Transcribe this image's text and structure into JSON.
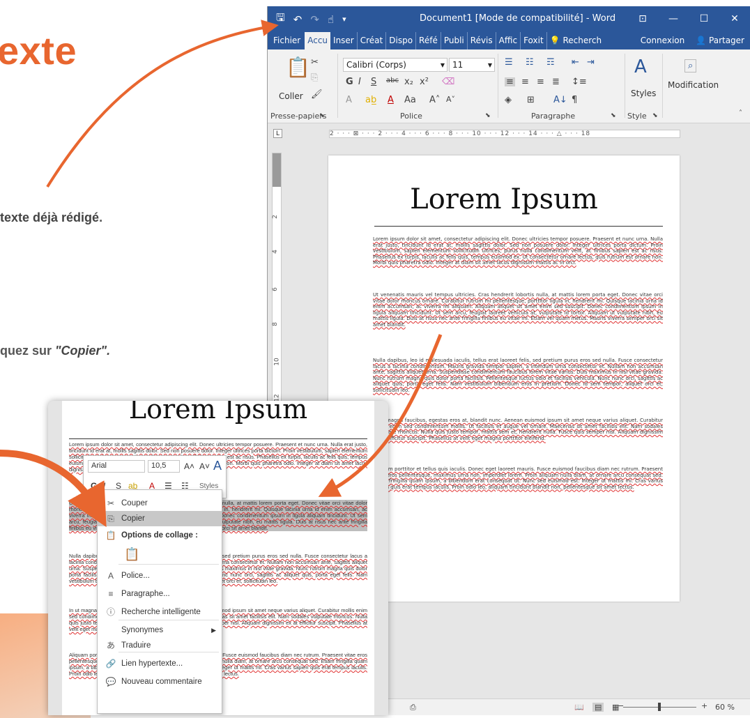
{
  "tutorial": {
    "heading": "exte",
    "line1_bold": "texte déjà rédigé",
    "line1_end": ".",
    "line2_start": "quez sur ",
    "line2_quote": "\"Copier\"."
  },
  "word": {
    "title": "Document1 [Mode de compatibilité] - Word",
    "tabs": [
      "Fichier",
      "Accu",
      "Inser",
      "Créat",
      "Dispo",
      "Réfé",
      "Publi",
      "Révis",
      "Affic",
      "Foxit"
    ],
    "tell_me": "Recherch",
    "connexion": "Connexion",
    "partager": "Partager",
    "ribbon": {
      "paste_label": "Coller",
      "font_name": "Calibri (Corps)",
      "font_size": "11",
      "styles_label": "Styles",
      "modification_label": "Modification",
      "groups": [
        "Presse-papiers",
        "Police",
        "Paragraphe",
        "Style"
      ]
    },
    "ruler_text": "2 · · · ⊠ · · · 2 · · · 4 · · · 6 · · · 8 · · · 10 · · · 12 · · · 14 · · · △ · · · 18",
    "vruler_numbers": [
      "2",
      "4",
      "6",
      "8",
      "10",
      "12"
    ],
    "page": {
      "title": "Lorem Ipsum",
      "paragraphs": [
        "Lorem ipsum dolor sit amet, consectetur adipiscing elit. Donec ultricies tempor posuere. Praesent et nunc urna. Nulla erat justo, tincidunt id erat at, mollis sagittis dolor. Sed non posuere dolor. Integer ultrices porta dictum. Proin vestibulum, sapien elementum sollicitudin ultrices, purus nulla condimentum velit, ac finibus sapien est ac risus. Phasellus ex turpis, iaculis ac felis quis, tempus euismod ex. Ut consectetur ornare lectus, quis rutrum est ornare non. Morbi quis pharetra odio. Integer at diam sit amet lacus dignissim mattis ac in orci.",
        "Ut venenatis mauris vel tempus ultricies. Cras hendrerit lobortis nulla, at mattis lorem porta eget. Donec vitae orci vitae dolor rhoncus ornare. Curabitur rutrum mi pellentesque, porttitor ligula in, hendrerit mi. Quisque lacinia urna id enim accumsan, ac viverra mi aliquam. Aliquam aliquet sit amet enim sed suscipit. Donec condimentum ipsum in ligula aliquam tincidunt. Ut sem arcu, feugiat laoreet vehicula at, vulputate id tortor. Aliquam ut vulputate nibh, eu mattis ligula. Duis at risus nec ante fringilla finibus eu vitae mi. Etiam vel quam metus. Mauris viverra semper orci sit amet blandit.",
        "Nulla dapibus, leo id malesuada iaculis, tellus erat laoreet felis, sed pretium purus eros sed nulla. Fusce consectetur lacus a lacinia condimentum. Mauris gravida tempor sapien, a interdum urna consectetur et. Nullam non accumsan ante, sagittis aliquet urna. Suspendisse condimentum faucibus lorem vitae varius. Duis maximus in nisl vitae gravida. Nunc rutrum magna quis dolor porta facilisis. Pellentesque luctus odio et facilisis vehicula. Nunc nunc orci, sagittis ac aliquet quis, porta eget felis. Nam vestibulum bibendum eros in pretium. Donec id sem tempor, aliquet orci et, sollicitudin leo.",
        "In ut magna faucibus, egestas eros at, blandit nunc. Aenean euismod ipsum sit amet neque varius aliquet. Curabitur mollis enim sed condimentum mollis. Ut facilisis et augue vel ornare. Maecenas sit amet facilisis elit. Nam sodales vulputate rhoncus. Nulla quis justo tempor, mattis sem et, hendrerit nulla. Fusce quis semper nisl. Aliquam dignissim ex at efficitur suscipit. Phasellus at velit eget magna porttitor eleifend.",
        "Aliquam porttitor et tellus quis iaculis. Donec eget laoreet mauris. Fusce euismod faucibus diam nec rutrum. Praesent vitae eros pellentesque, maximus urna non, imperdiet lorem. Proin aliquam nulla diam, at ornare arcu consequat sed. Etiam fringilla quam ipsum, a bibendum erat consequat ut. Nunc sed euismod est. Integer ut mattis mi. Cras varius sapien quis erat tempus iaculis. Proin odio leo, aliquam tincidunt blandit non, pellentesque sit amet lectus."
      ]
    },
    "status": {
      "zoom": "60 %"
    }
  },
  "inset": {
    "mini_toolbar": {
      "font": "Arial",
      "size": "10,5",
      "styles": "Styles"
    },
    "context_menu": [
      {
        "label": "Couper",
        "icon": "scissors-icon",
        "glyph": "✂"
      },
      {
        "label": "Copier",
        "icon": "copy-icon",
        "glyph": "⎘",
        "highlight": true
      },
      {
        "label": "Options de collage :",
        "icon": "paste-options-icon",
        "glyph": "📋",
        "header": true
      },
      {
        "label": "",
        "icon": "paste-keep-format-icon",
        "glyph": "📋"
      },
      {
        "label": "Police...",
        "icon": "font-icon",
        "glyph": "A"
      },
      {
        "label": "Paragraphe...",
        "icon": "paragraph-icon",
        "glyph": "≡"
      },
      {
        "label": "Recherche intelligente",
        "icon": "smart-lookup-icon",
        "glyph": "ⓘ"
      },
      {
        "label": "Synonymes",
        "icon": "",
        "glyph": "",
        "submenu": true
      },
      {
        "label": "Traduire",
        "icon": "translate-icon",
        "glyph": "あ"
      },
      {
        "label": "Lien hypertexte...",
        "icon": "hyperlink-icon",
        "glyph": "🔗"
      },
      {
        "label": "Nouveau commentaire",
        "icon": "new-comment-icon",
        "glyph": "💬"
      }
    ]
  },
  "colors": {
    "accent_orange": "#e8662f",
    "word_blue": "#2b579a"
  }
}
